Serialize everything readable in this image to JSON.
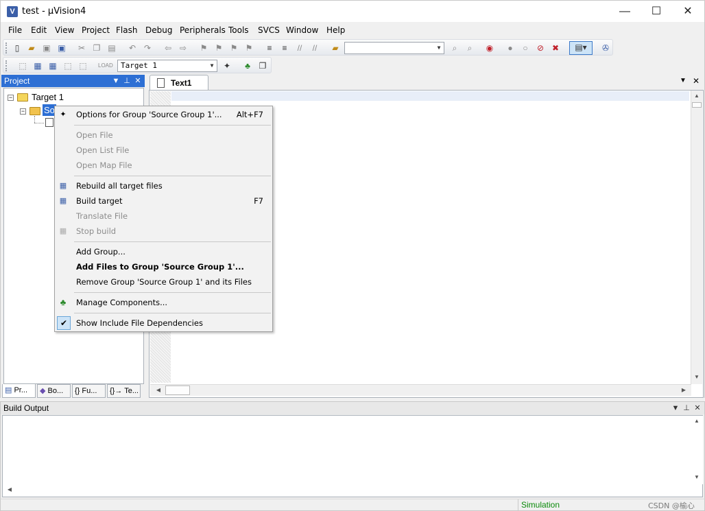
{
  "window": {
    "title": "test  - µVision4",
    "min": "—",
    "max": "☐",
    "close": "✕"
  },
  "menu": [
    "File",
    "Edit",
    "View",
    "Project",
    "Flash",
    "Debug",
    "Peripherals",
    "Tools",
    "SVCS",
    "Window",
    "Help"
  ],
  "toolbar": {
    "target_select": "Target 1"
  },
  "project_panel": {
    "title": "Project",
    "tree": {
      "target": "Target 1",
      "group_selected": "So"
    },
    "tabs": [
      "Pr...",
      "Bo...",
      "{} Fu...",
      "{}→ Te..."
    ]
  },
  "editor": {
    "tab": "Text1"
  },
  "build_output": {
    "title": "Build Output"
  },
  "status": {
    "mode": "Simulation",
    "watermark": "CSDN @榆心"
  },
  "context_menu": {
    "options_group": {
      "label": "Options for Group 'Source Group 1'...",
      "shortcut": "Alt+F7"
    },
    "open_file": "Open File",
    "open_list": "Open List File",
    "open_map": "Open Map File",
    "rebuild_all": "Rebuild all target files",
    "build_target": {
      "label": "Build target",
      "shortcut": "F7"
    },
    "translate": "Translate File",
    "stop_build": "Stop build",
    "add_group": "Add Group...",
    "add_files": "Add Files to Group 'Source Group 1'...",
    "remove_group": "Remove Group 'Source Group 1' and its Files",
    "manage_components": "Manage Components...",
    "show_include": "Show Include File Dependencies"
  },
  "icons": {
    "check": "✔",
    "wand": "✦",
    "down": "▼",
    "pin": "⊥",
    "x": "✕"
  }
}
